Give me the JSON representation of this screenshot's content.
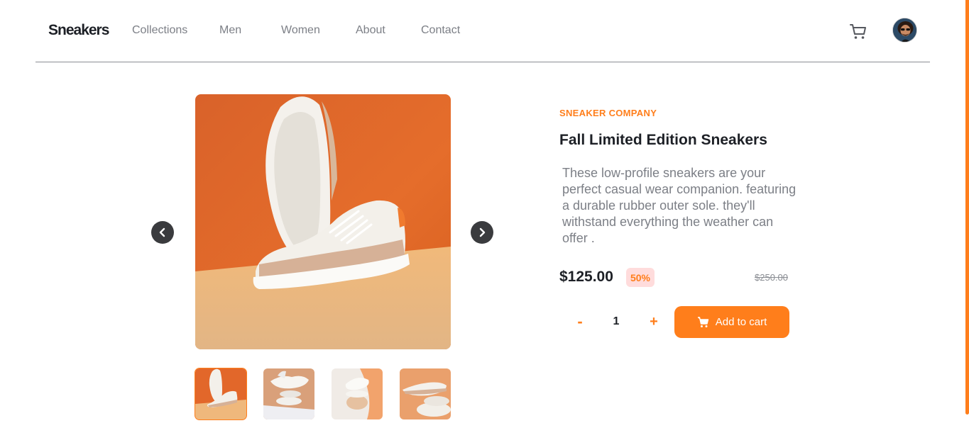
{
  "header": {
    "logo": "Sneakers",
    "nav": [
      "Collections",
      "Men",
      "Women",
      "About",
      "Contact"
    ],
    "cart_icon": "cart-icon",
    "avatar": "user-avatar"
  },
  "gallery": {
    "main_image": "white leather sneakers on orange background",
    "prev_icon": "chevron-left-icon",
    "next_icon": "chevron-right-icon",
    "thumbnails": [
      "thumbnail-1",
      "thumbnail-2",
      "thumbnail-3",
      "thumbnail-4"
    ],
    "active_thumbnail": 1
  },
  "product": {
    "company": "SNEAKER COMPANY",
    "title": "Fall Limited Edition Sneakers",
    "description": "These low-profile sneakers are your perfect casual wear companion. featuring a durable rubber outer sole. they'll withstand everything the weather can offer .",
    "price": "$125.00",
    "discount": "50%",
    "old_price": "$250.00"
  },
  "cart_controls": {
    "minus": "-",
    "quantity": "1",
    "plus": "+",
    "add_label": "Add to cart"
  },
  "colors": {
    "accent": "#ff7e1b",
    "dark": "#1d2026",
    "muted": "#7c7f86",
    "discount_bg": "#ffdcdc"
  }
}
